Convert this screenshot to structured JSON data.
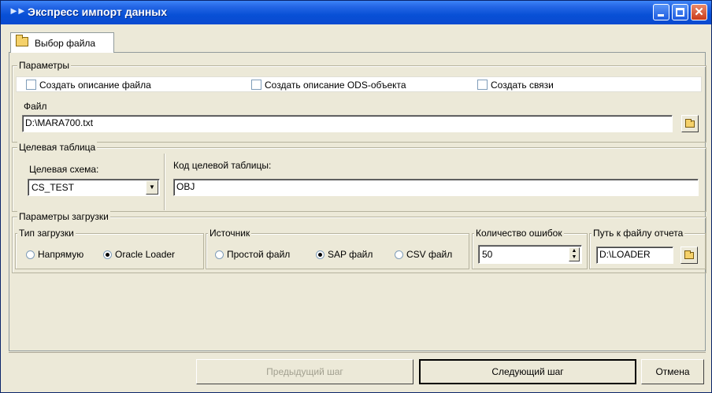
{
  "window": {
    "title": "Экспресс импорт данных"
  },
  "tabs": [
    {
      "label": "Выбор файла"
    }
  ],
  "params": {
    "legend": "Параметры",
    "checkboxes": [
      {
        "label": "Создать описание файла",
        "checked": false
      },
      {
        "label": "Создать описание ODS-объекта",
        "checked": false
      },
      {
        "label": "Создать связи",
        "checked": false
      }
    ],
    "file_label": "Файл",
    "file_value": "D:\\MARA700.txt"
  },
  "target": {
    "legend": "Целевая таблица",
    "schema_label": "Целевая схема:",
    "schema_value": "CS_TEST",
    "code_label": "Код целевой таблицы:",
    "code_value": "OBJ"
  },
  "load": {
    "legend": "Параметры загрузки",
    "type_legend": "Тип загрузки",
    "type_options": [
      {
        "label": "Напрямую",
        "selected": false
      },
      {
        "label": "Oracle Loader",
        "selected": true
      }
    ],
    "source_legend": "Источник",
    "source_options": [
      {
        "label": "Простой файл",
        "selected": false
      },
      {
        "label": "SAP файл",
        "selected": true
      },
      {
        "label": "CSV файл",
        "selected": false
      }
    ],
    "errors_legend": "Количество ошибок",
    "errors_value": "50",
    "report_legend": "Путь к файлу отчета",
    "report_value": "D:\\LOADER"
  },
  "buttons": {
    "prev": "Предыдущий шаг",
    "next": "Следующий шаг",
    "cancel": "Отмена"
  }
}
